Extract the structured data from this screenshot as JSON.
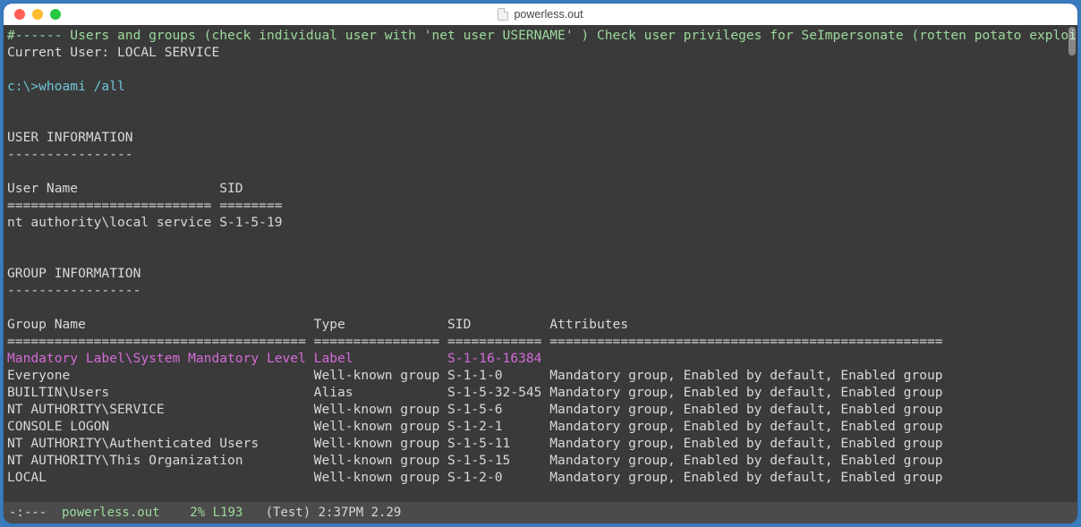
{
  "window": {
    "title": "powerless.out"
  },
  "lines": {
    "header": "#------ Users and groups (check individual user with 'net user USERNAME' ) Check user privileges for SeImpersonate (rotten potato exploit) -------",
    "current_user": "Current User: LOCAL SERVICE",
    "blank": "",
    "prompt": "c:\\>whoami /all",
    "user_info_hdr": "USER INFORMATION",
    "user_info_dash": "----------------",
    "user_cols": "User Name                  SID     ",
    "user_cols_eq": "========================== ========",
    "user_row": "nt authority\\local service S-1-5-19",
    "group_info_hdr": "GROUP INFORMATION",
    "group_info_dash": "-----------------",
    "group_cols": "Group Name                             Type             SID          Attributes                                        ",
    "group_cols_eq": "====================================== ================ ============ ==================================================",
    "group_r0": "Mandatory Label\\System Mandatory Level Label            S-1-16-16384                                                   ",
    "group_r1": "Everyone                               Well-known group S-1-1-0      Mandatory group, Enabled by default, Enabled group",
    "group_r2": "BUILTIN\\Users                          Alias            S-1-5-32-545 Mandatory group, Enabled by default, Enabled group",
    "group_r3": "NT AUTHORITY\\SERVICE                   Well-known group S-1-5-6      Mandatory group, Enabled by default, Enabled group",
    "group_r4": "CONSOLE LOGON                          Well-known group S-1-2-1      Mandatory group, Enabled by default, Enabled group",
    "group_r5": "NT AUTHORITY\\Authenticated Users       Well-known group S-1-5-11     Mandatory group, Enabled by default, Enabled group",
    "group_r6": "NT AUTHORITY\\This Organization         Well-known group S-1-5-15     Mandatory group, Enabled by default, Enabled group",
    "group_r7": "LOCAL                                  Well-known group S-1-2-0      Mandatory group, Enabled by default, Enabled group"
  },
  "statusbar": {
    "left": "-:--- ",
    "filename": " powerless.out ",
    "percent": "   2% L193   ",
    "rest": "(Test) 2:37PM 2.29"
  }
}
